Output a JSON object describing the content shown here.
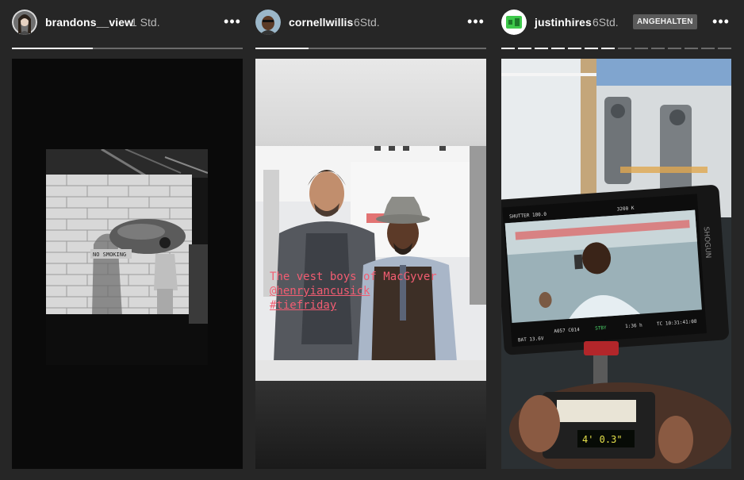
{
  "stories": [
    {
      "username": "brandons__view",
      "time": "1 Std.",
      "more_label": "•••",
      "progress": [
        0.35
      ],
      "photo_sign": "NO SMOKING"
    },
    {
      "username": "cornellwillis",
      "time": "6Std.",
      "more_label": "•••",
      "progress": [
        0.23
      ],
      "caption": {
        "line1": "The vest boys of MacGyver",
        "line2": "@henryiancusick",
        "line3": "#tiefriday"
      }
    },
    {
      "username": "justinhires",
      "time": "6Std.",
      "badge": "ANGEHALTEN",
      "more_label": "•••",
      "progress": [
        1,
        1,
        1,
        1,
        1,
        1,
        1,
        0,
        0,
        0,
        0,
        0,
        0,
        0
      ],
      "monitor": {
        "shutter": "SHUTTER 180.0",
        "wb": "3200 K",
        "tc": "TC 10:31:41:08",
        "bat": "BAT 13.6V",
        "clip": "A057 C014",
        "stby": "STBY",
        "fps": "1:36 h"
      },
      "recorder_display": "4' 0.3\""
    }
  ],
  "colors": {
    "background": "#262626",
    "caption": "#f25d72",
    "progress_track": "#6b6b6b",
    "progress_fill": "#ffffff",
    "badge_bg": "#5a5a5a"
  }
}
